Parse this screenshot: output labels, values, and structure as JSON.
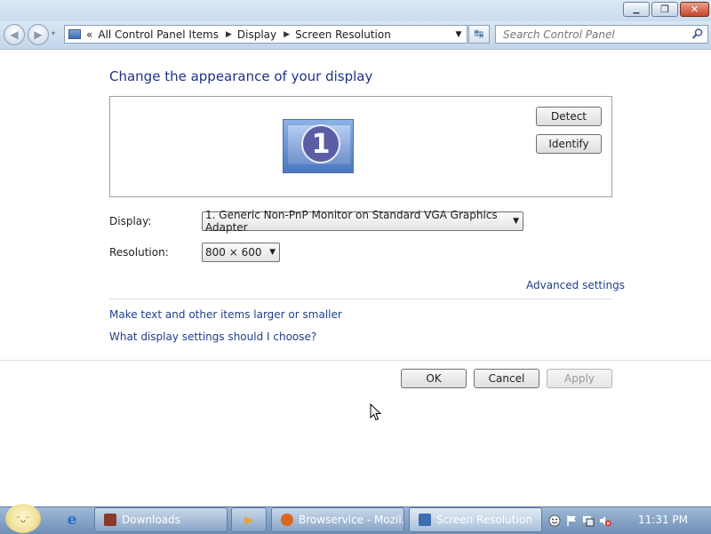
{
  "window": {
    "minimize_glyph": "▁",
    "maximize_glyph": "❐",
    "close_glyph": "✕"
  },
  "navbar": {
    "back_glyph": "◀",
    "forward_glyph": "▶",
    "recent_glyph": "▾",
    "breadcrumb_overflow": "«",
    "breadcrumb": [
      "All Control Panel Items",
      "Display",
      "Screen Resolution"
    ],
    "crumb_separator": "▶",
    "dropdown_glyph": "▼",
    "refresh_glyph": "↹",
    "search_placeholder": "Search Control Panel"
  },
  "main": {
    "heading": "Change the appearance of your display",
    "monitor_number": "1",
    "detect_label": "Detect",
    "identify_label": "Identify",
    "display_label": "Display:",
    "display_value": "1. Generic Non-PnP Monitor on Standard VGA Graphics Adapter",
    "resolution_label": "Resolution:",
    "resolution_value": "800 × 600",
    "advanced_link": "Advanced settings",
    "link_larger": "Make text and other items larger or smaller",
    "link_which": "What display settings should I choose?",
    "ok_label": "OK",
    "cancel_label": "Cancel",
    "apply_label": "Apply"
  },
  "taskbar": {
    "start_glyph": "ᵔᴗᵔ",
    "ie_glyph": "e",
    "media_glyph": "▶",
    "buttons": [
      {
        "label": "Downloads",
        "icon": "downloads-icon",
        "color": "#8a3a2a"
      },
      {
        "label": "Browservice - Mozil...",
        "icon": "firefox-icon",
        "color": "#d9661f"
      },
      {
        "label": "Screen Resolution",
        "icon": "control-panel-icon",
        "color": "#3d6cb0"
      }
    ],
    "clock": "11:31 PM"
  },
  "colors": {
    "heading": "#1e3287",
    "link": "#1e3f8c",
    "taskbar": "#7f9cc2"
  }
}
